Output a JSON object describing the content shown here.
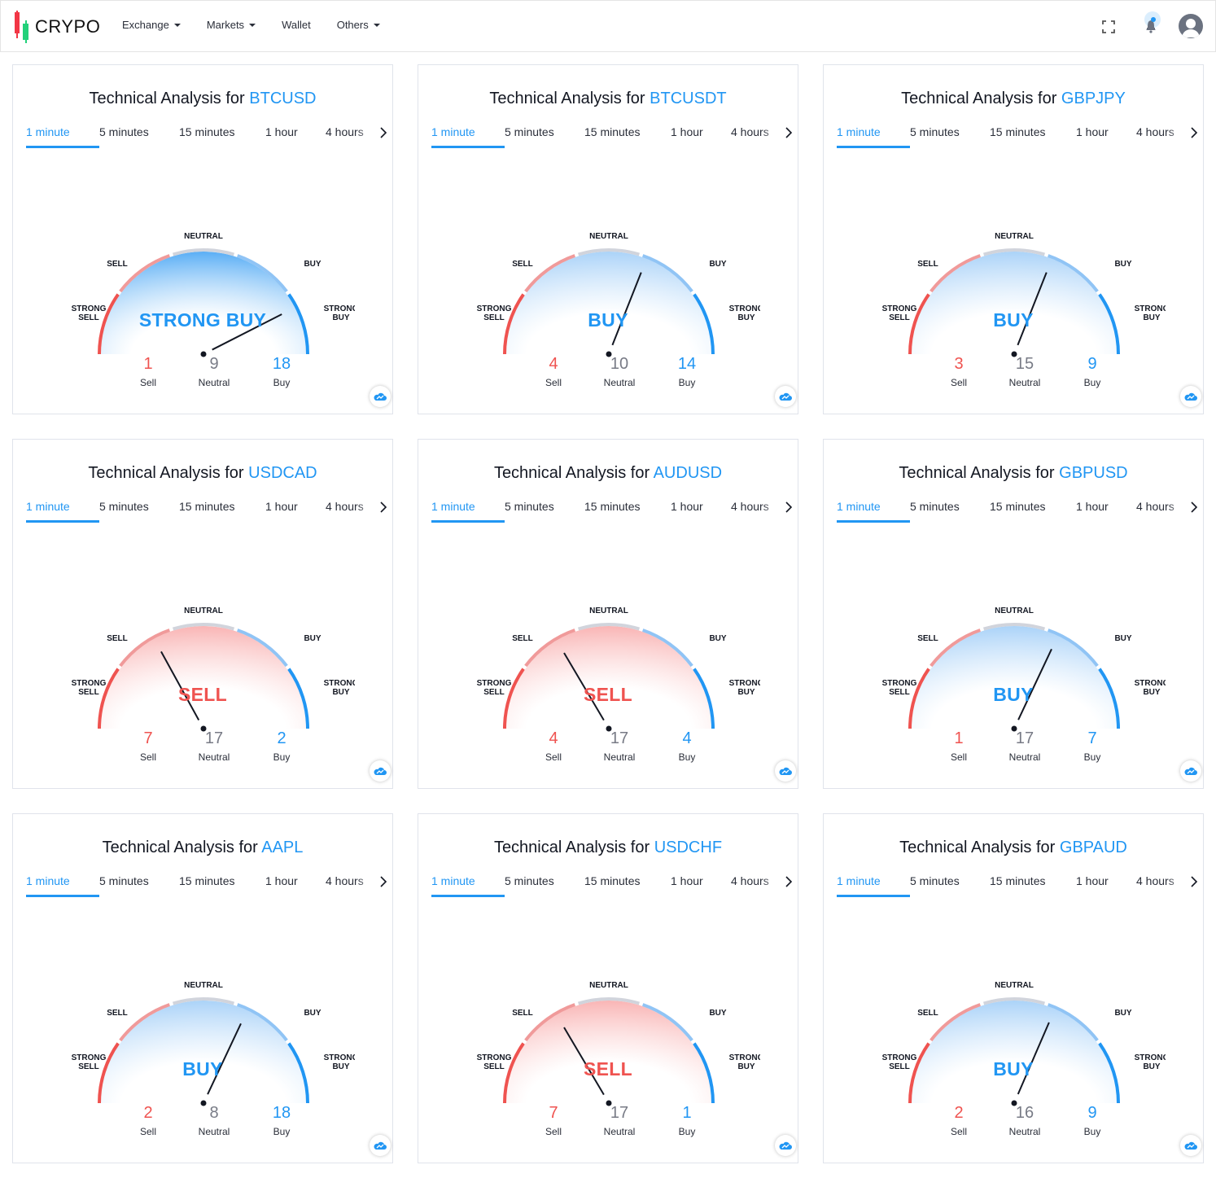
{
  "app": {
    "logo_text": "CRYPO",
    "nav": [
      {
        "label": "Exchange",
        "has_dropdown": true
      },
      {
        "label": "Markets",
        "has_dropdown": true
      },
      {
        "label": "Wallet",
        "has_dropdown": false
      },
      {
        "label": "Others",
        "has_dropdown": true
      }
    ]
  },
  "common": {
    "title_prefix": "Technical Analysis for ",
    "tabs": [
      "1 minute",
      "5 minutes",
      "15 minutes",
      "1 hour",
      "4 hours"
    ],
    "active_tab": "1 minute",
    "gauge_labels": {
      "neutral": "NEUTRAL",
      "sell": "SELL",
      "buy": "BUY",
      "strong_sell": [
        "STRONG",
        "SELL"
      ],
      "strong_buy": [
        "STRONG",
        "BUY"
      ]
    },
    "count_labels": {
      "sell": "Sell",
      "neutral": "Neutral",
      "buy": "Buy"
    }
  },
  "colors": {
    "buy": "#2196f3",
    "sell": "#ef5350",
    "neutral": "#787b86"
  },
  "widgets": [
    {
      "symbol": "BTCUSD",
      "signal": "STRONG BUY",
      "sentiment": "strong_buy",
      "needle_value": 0.85,
      "sell": "1",
      "neutral": "9",
      "buy": "18"
    },
    {
      "symbol": "BTCUSDT",
      "signal": "BUY",
      "sentiment": "buy",
      "needle_value": 0.62,
      "sell": "4",
      "neutral": "10",
      "buy": "14"
    },
    {
      "symbol": "GBPJPY",
      "signal": "BUY",
      "sentiment": "buy",
      "needle_value": 0.62,
      "sell": "3",
      "neutral": "15",
      "buy": "9"
    },
    {
      "symbol": "USDCAD",
      "signal": "SELL",
      "sentiment": "sell",
      "needle_value": 0.34,
      "sell": "7",
      "neutral": "17",
      "buy": "2"
    },
    {
      "symbol": "AUDUSD",
      "signal": "SELL",
      "sentiment": "sell",
      "needle_value": 0.33,
      "sell": "4",
      "neutral": "17",
      "buy": "4"
    },
    {
      "symbol": "GBPUSD",
      "signal": "BUY",
      "sentiment": "buy",
      "needle_value": 0.64,
      "sell": "1",
      "neutral": "17",
      "buy": "7"
    },
    {
      "symbol": "AAPL",
      "signal": "BUY",
      "sentiment": "buy",
      "needle_value": 0.64,
      "sell": "2",
      "neutral": "8",
      "buy": "18"
    },
    {
      "symbol": "USDCHF",
      "signal": "SELL",
      "sentiment": "sell",
      "needle_value": 0.33,
      "sell": "7",
      "neutral": "17",
      "buy": "1"
    },
    {
      "symbol": "GBPAUD",
      "signal": "BUY",
      "sentiment": "buy",
      "needle_value": 0.63,
      "sell": "2",
      "neutral": "16",
      "buy": "9"
    }
  ]
}
